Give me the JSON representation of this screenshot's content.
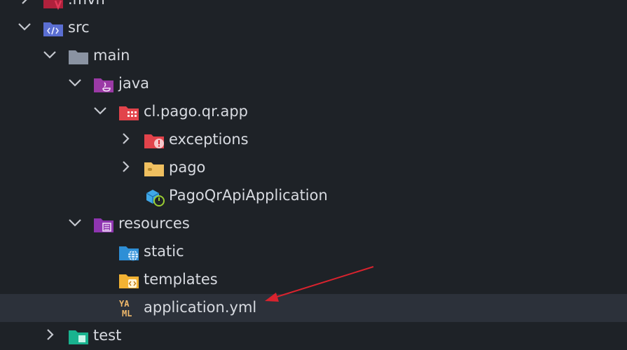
{
  "tree": {
    "items": [
      {
        "label": ".mvn",
        "icon": "maven-folder-icon",
        "expanded": false
      },
      {
        "label": "src",
        "icon": "source-folder-icon",
        "expanded": true
      },
      {
        "label": "main",
        "icon": "folder-icon",
        "expanded": true
      },
      {
        "label": "java",
        "icon": "java-folder-icon",
        "expanded": true
      },
      {
        "label": "cl.pago.qr.app",
        "icon": "package-folder-icon",
        "expanded": true
      },
      {
        "label": "exceptions",
        "icon": "exceptions-folder-icon",
        "expanded": false
      },
      {
        "label": "pago",
        "icon": "folder-icon",
        "expanded": false
      },
      {
        "label": "PagoQrApiApplication",
        "icon": "spring-class-icon"
      },
      {
        "label": "resources",
        "icon": "resources-folder-icon",
        "expanded": true
      },
      {
        "label": "static",
        "icon": "web-folder-icon"
      },
      {
        "label": "templates",
        "icon": "templates-folder-icon"
      },
      {
        "label": "application.yml",
        "icon": "yaml-file-icon",
        "selected": true,
        "icon_text": [
          "YA",
          "ML"
        ]
      },
      {
        "label": "test",
        "icon": "test-folder-icon",
        "expanded": false
      }
    ]
  },
  "annotation": {
    "icon": "red-arrow-icon",
    "color": "#d9232e"
  },
  "colors": {
    "background": "#1e2227",
    "selected_row": "#2c313a",
    "text": "#d7dae0",
    "chevron": "#c5c8cf"
  }
}
